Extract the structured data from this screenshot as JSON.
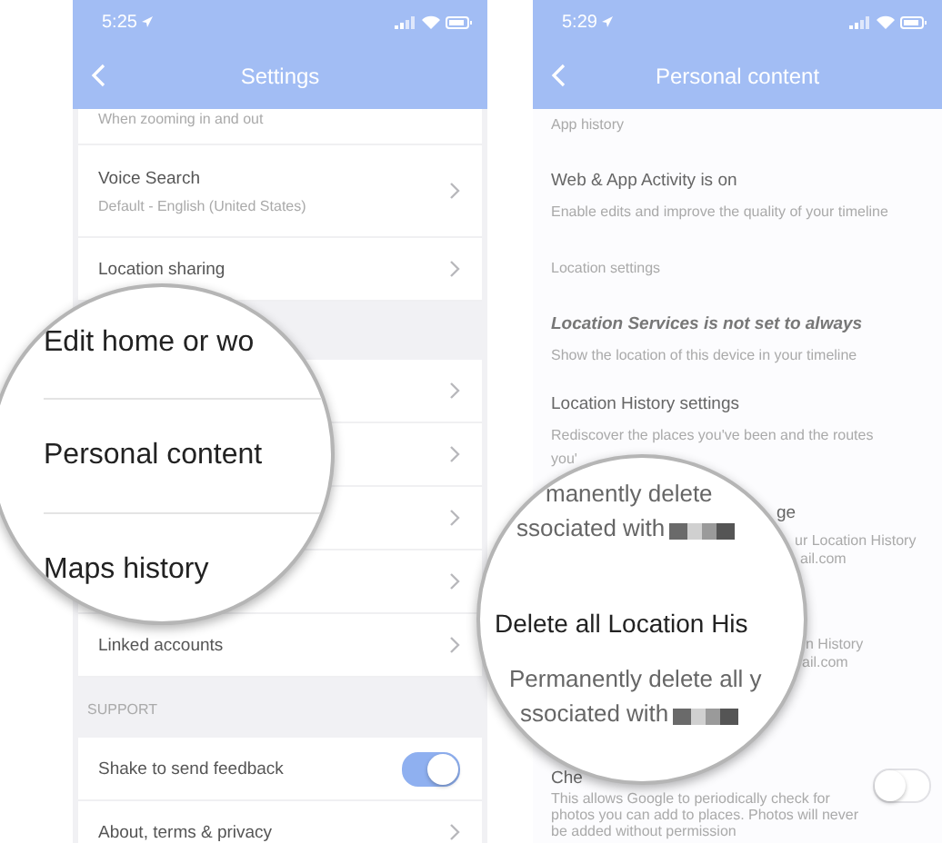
{
  "left_phone": {
    "time": "5:25",
    "title": "Settings",
    "groups": [
      {
        "items": [
          {
            "kind": "cut",
            "subtitle": "When zooming in and out"
          },
          {
            "kind": "row",
            "title": "Voice Search",
            "subtitle": "Default - English (United States)"
          },
          {
            "kind": "row",
            "title": "Location sharing"
          }
        ]
      },
      {
        "items": [
          {
            "kind": "covered"
          },
          {
            "kind": "covered"
          },
          {
            "kind": "covered"
          },
          {
            "kind": "covered"
          },
          {
            "kind": "row",
            "title": "Linked accounts"
          }
        ]
      },
      {
        "header": "SUPPORT",
        "items": [
          {
            "kind": "toggle",
            "title": "Shake to send feedback",
            "on": true
          },
          {
            "kind": "row",
            "title": "About, terms & privacy"
          }
        ]
      }
    ],
    "magnifier": {
      "lines": [
        {
          "kind": "title",
          "text": "Edit home or wo"
        },
        {
          "kind": "title",
          "text": "Personal content"
        },
        {
          "kind": "title",
          "text": "Maps history"
        }
      ]
    }
  },
  "right_phone": {
    "time": "5:29",
    "title": "Personal content",
    "items": [
      {
        "kind": "section",
        "title": "App history"
      },
      {
        "kind": "row",
        "title": "Web & App Activity is on",
        "subtitle": "Enable edits and improve the quality of your timeline"
      },
      {
        "kind": "section",
        "title": "Location settings"
      },
      {
        "kind": "row",
        "title": "Location Services is not set to always",
        "emphasis": true,
        "subtitle": "Show the location of this device in your timeline"
      },
      {
        "kind": "row",
        "title": "Location History settings",
        "subtitle": "Rediscover the places you've been and the routes",
        "subtitle_2": "you'"
      },
      {
        "kind": "partial",
        "title": "ge",
        "subtitle": "ur Location History",
        "subtitle_2": "ail.com"
      },
      {
        "kind": "partial",
        "subtitle": "n History",
        "subtitle_2": "ail.com"
      },
      {
        "kind": "toggle",
        "title": "Che",
        "on": false,
        "subtitle": "This allows Google to periodically check for photos you can add to places. Photos will never be added without permission"
      }
    ],
    "magnifier": {
      "lines": [
        {
          "kind": "subtitle",
          "text": "manently delete",
          "redacted": false
        },
        {
          "kind": "subtitle",
          "text": "ssociated with",
          "redacted": true
        },
        {
          "kind": "title",
          "text": "Delete all Location His",
          "redacted": false
        },
        {
          "kind": "subtitle",
          "text": "Permanently delete all y",
          "redacted": false
        },
        {
          "kind": "subtitle",
          "text": "ssociated with",
          "redacted": true
        }
      ]
    }
  }
}
